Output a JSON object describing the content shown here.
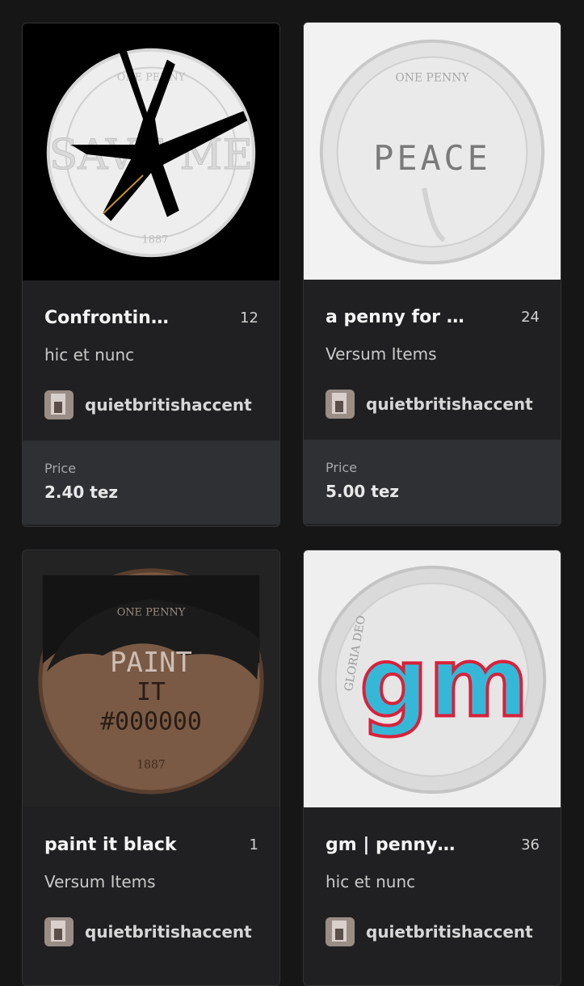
{
  "cards": [
    {
      "title": "Confrontin…",
      "count": "12",
      "platform": "hic et nunc",
      "creator": "quietbritishaccent",
      "price_label": "Price",
      "price_value": "2.40 tez",
      "coin_text": "SAVE ME",
      "coin_year": "1887",
      "coin_rim": "ONE PENNY"
    },
    {
      "title": "a penny for …",
      "count": "24",
      "platform": "Versum Items",
      "creator": "quietbritishaccent",
      "price_label": "Price",
      "price_value": "5.00 tez",
      "coin_text": "PEACE",
      "coin_rim": "ONE PENNY"
    },
    {
      "title": "paint it black",
      "count": "1",
      "platform": "Versum Items",
      "creator": "quietbritishaccent",
      "coin_text_line1": "PAINT",
      "coin_text_line2": "IT",
      "coin_text_line3": "#000000",
      "coin_year": "1887",
      "coin_rim": "ONE PENNY"
    },
    {
      "title": "gm | penny…",
      "count": "36",
      "platform": "hic et nunc",
      "creator": "quietbritishaccent",
      "coin_text": "gm",
      "coin_rim": "GLORIA DEO"
    }
  ]
}
